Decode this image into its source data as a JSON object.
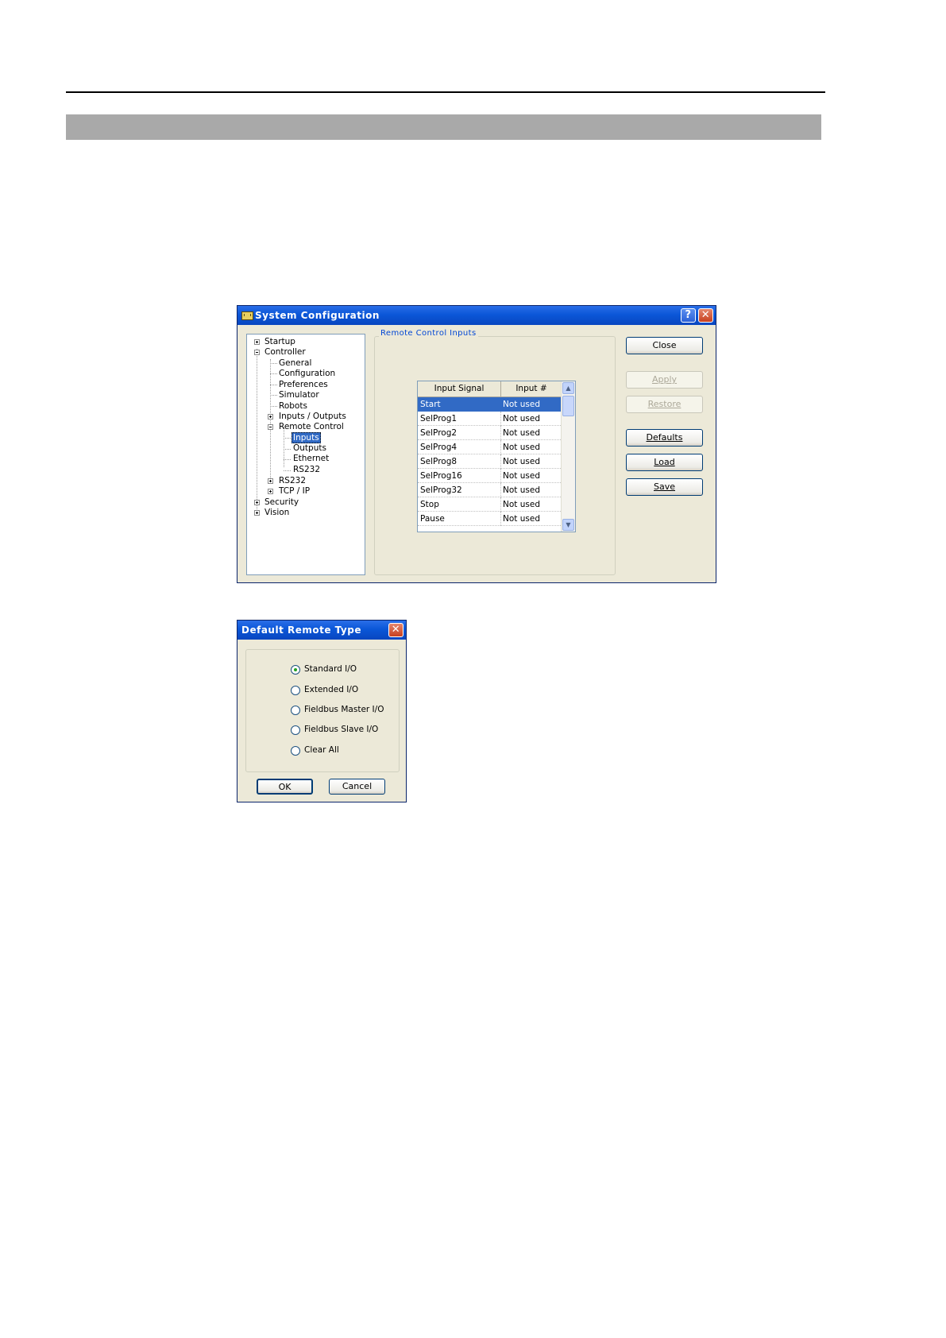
{
  "system_config": {
    "title": "System Configuration",
    "tree": {
      "startup": "Startup",
      "controller": "Controller",
      "general": "General",
      "configuration": "Configuration",
      "preferences": "Preferences",
      "simulator": "Simulator",
      "robots": "Robots",
      "inputs_outputs": "Inputs / Outputs",
      "remote_control": "Remote Control",
      "inputs": "Inputs",
      "outputs": "Outputs",
      "ethernet": "Ethernet",
      "rs232_child": "RS232",
      "rs232": "RS232",
      "tcpip": "TCP / IP",
      "security": "Security",
      "vision": "Vision"
    },
    "group_label": "Remote Control Inputs",
    "table": {
      "headers": [
        "Input Signal",
        "Input #"
      ],
      "rows": [
        {
          "signal": "Start",
          "input": "Not used"
        },
        {
          "signal": "SelProg1",
          "input": "Not used"
        },
        {
          "signal": "SelProg2",
          "input": "Not used"
        },
        {
          "signal": "SelProg4",
          "input": "Not used"
        },
        {
          "signal": "SelProg8",
          "input": "Not used"
        },
        {
          "signal": "SelProg16",
          "input": "Not used"
        },
        {
          "signal": "SelProg32",
          "input": "Not used"
        },
        {
          "signal": "Stop",
          "input": "Not used"
        },
        {
          "signal": "Pause",
          "input": "Not used"
        }
      ]
    },
    "buttons": {
      "close": "Close",
      "apply": "Apply",
      "restore": "Restore",
      "defaults": "Defaults",
      "load": "Load",
      "save": "Save"
    }
  },
  "default_remote_type": {
    "title": "Default Remote Type",
    "options": [
      {
        "label": "Standard I/O",
        "selected": true
      },
      {
        "label": "Extended I/O",
        "selected": false
      },
      {
        "label": "Fieldbus Master I/O",
        "selected": false
      },
      {
        "label": "Fieldbus Slave I/O",
        "selected": false
      },
      {
        "label": "Clear All",
        "selected": false
      }
    ],
    "ok": "OK",
    "cancel": "Cancel"
  }
}
